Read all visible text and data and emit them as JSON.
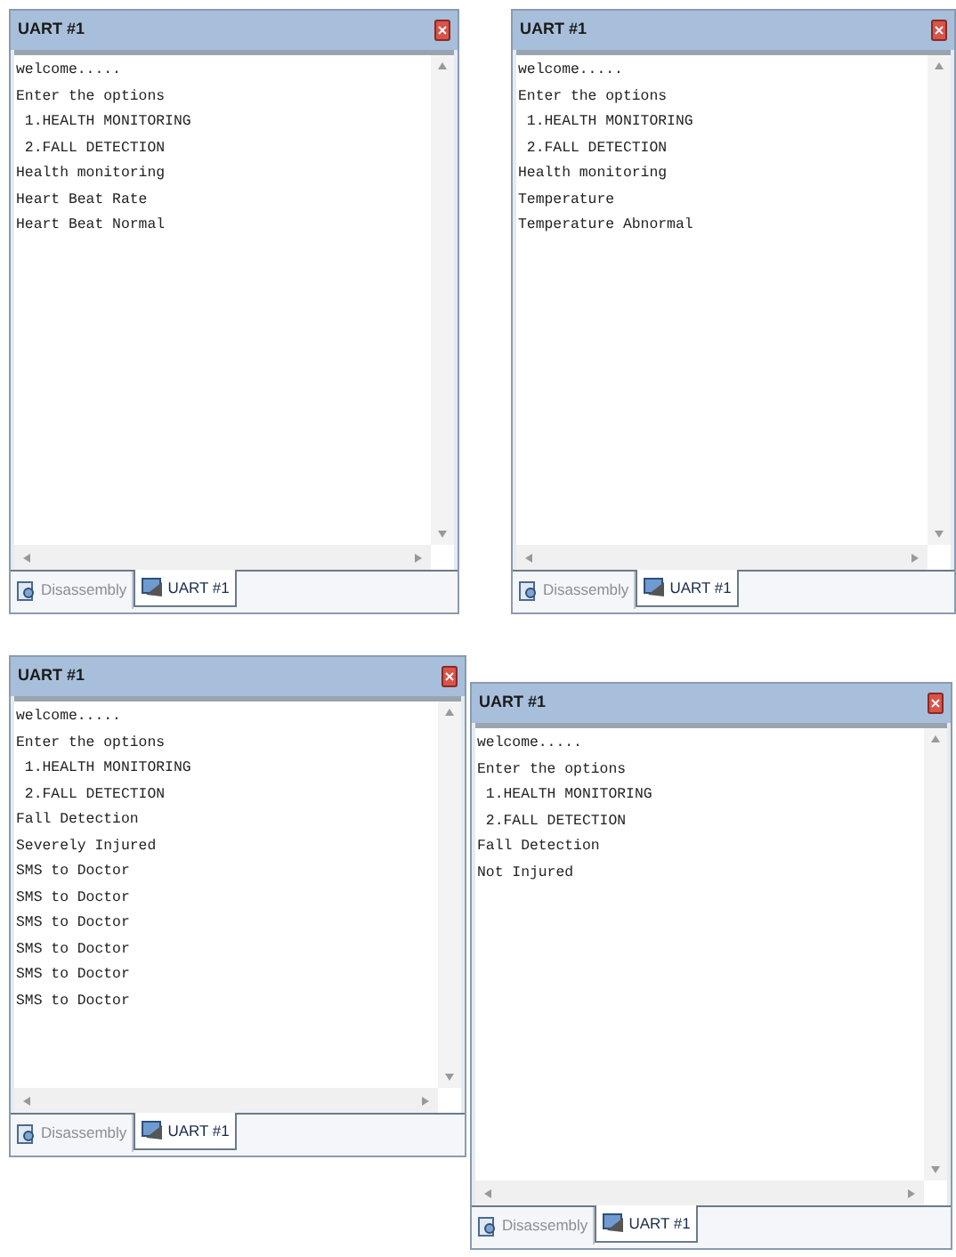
{
  "windows": [
    {
      "title": "UART #1",
      "lines": [
        "welcome.....",
        "Enter the options",
        " 1.HEALTH MONITORING",
        " 2.FALL DETECTION",
        "Health monitoring",
        "Heart Beat Rate",
        "Heart Beat Normal"
      ],
      "tabs": [
        {
          "kind": "disassembly",
          "label": "Disassembly",
          "selected": false
        },
        {
          "kind": "uart",
          "label": "UART #1",
          "selected": true
        }
      ]
    },
    {
      "title": "UART #1",
      "lines": [
        "welcome.....",
        "Enter the options",
        " 1.HEALTH MONITORING",
        " 2.FALL DETECTION",
        "Health monitoring",
        "Temperature",
        "Temperature Abnormal"
      ],
      "tabs": [
        {
          "kind": "disassembly",
          "label": "Disassembly",
          "selected": false
        },
        {
          "kind": "uart",
          "label": "UART #1",
          "selected": true
        }
      ]
    },
    {
      "title": "UART #1",
      "lines": [
        "welcome.....",
        "Enter the options",
        " 1.HEALTH MONITORING",
        " 2.FALL DETECTION",
        "Fall Detection",
        "Severely Injured",
        "SMS to Doctor",
        "SMS to Doctor",
        "SMS to Doctor",
        "SMS to Doctor",
        "SMS to Doctor",
        "SMS to Doctor"
      ],
      "tabs": [
        {
          "kind": "disassembly",
          "label": "Disassembly",
          "selected": false
        },
        {
          "kind": "uart",
          "label": "UART #1",
          "selected": true
        }
      ]
    },
    {
      "title": "UART #1",
      "lines": [
        "welcome.....",
        "Enter the options",
        " 1.HEALTH MONITORING",
        " 2.FALL DETECTION",
        "Fall Detection",
        "Not Injured"
      ],
      "tabs": [
        {
          "kind": "disassembly",
          "label": "Disassembly",
          "selected": false
        },
        {
          "kind": "uart",
          "label": "UART #1",
          "selected": true
        }
      ]
    }
  ]
}
